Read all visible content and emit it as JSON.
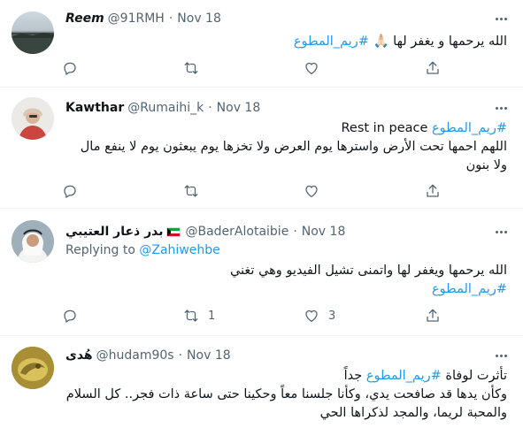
{
  "tweets": [
    {
      "name": "Reem",
      "handle": "@91RMH",
      "sep": "·",
      "date": "Nov 18",
      "text_lead": "الله يرحمها و يغفر لها ",
      "text_emoji": "🙏🏻",
      "hashtag": "#ريم_المطوع",
      "reply_count": "",
      "retweet_count": "",
      "like_count": ""
    },
    {
      "name": "Kawthar",
      "handle": "@Rumaihi_k",
      "sep": "·",
      "date": "Nov 18",
      "text_line1_latin": "Rest in peace",
      "hashtag": "#ريم_المطوع",
      "text_body": "اللهم احمها تحت الأرض واسترها يوم العرض ولا تخزها يوم يبعثون يوم لا ينفع مال ولا بنون"
    },
    {
      "name": "بدر ذعار العتيبي",
      "handle": "@BaderAlotaibie",
      "sep": "·",
      "date": "Nov 18",
      "replying_prefix": "Replying to",
      "replying_to": "@Zahiwehbe",
      "text_body": "الله يرحمها ويغفر لها واتمنى تشيل الفيديو وهي تغني",
      "hashtag": "#ريم_المطوع",
      "retweet_count": "1",
      "like_count": "3"
    },
    {
      "name": "هُدى",
      "handle": "@hudam90s",
      "sep": "·",
      "date": "Nov 18",
      "text_lead": "تأثرت لوفاة ",
      "hashtag": "#ريم_المطوع",
      "text_after_hashtag": " جداً",
      "text_body": "وكأن يدها قد صافحت يدي، وكأنا جلسنا معاً وحكينا حتى ساعة ذات فجر.. كل السلام والمحبة لريما، والمجد لذكراها الحي"
    }
  ],
  "icons": {
    "reply": "reply-icon",
    "retweet": "retweet-icon",
    "like": "heart-icon",
    "share": "share-icon",
    "more": "more-icon"
  },
  "colors": {
    "hashtag": "#1d9bf0",
    "secondary_text": "#536471",
    "divider": "#eff3f4"
  }
}
